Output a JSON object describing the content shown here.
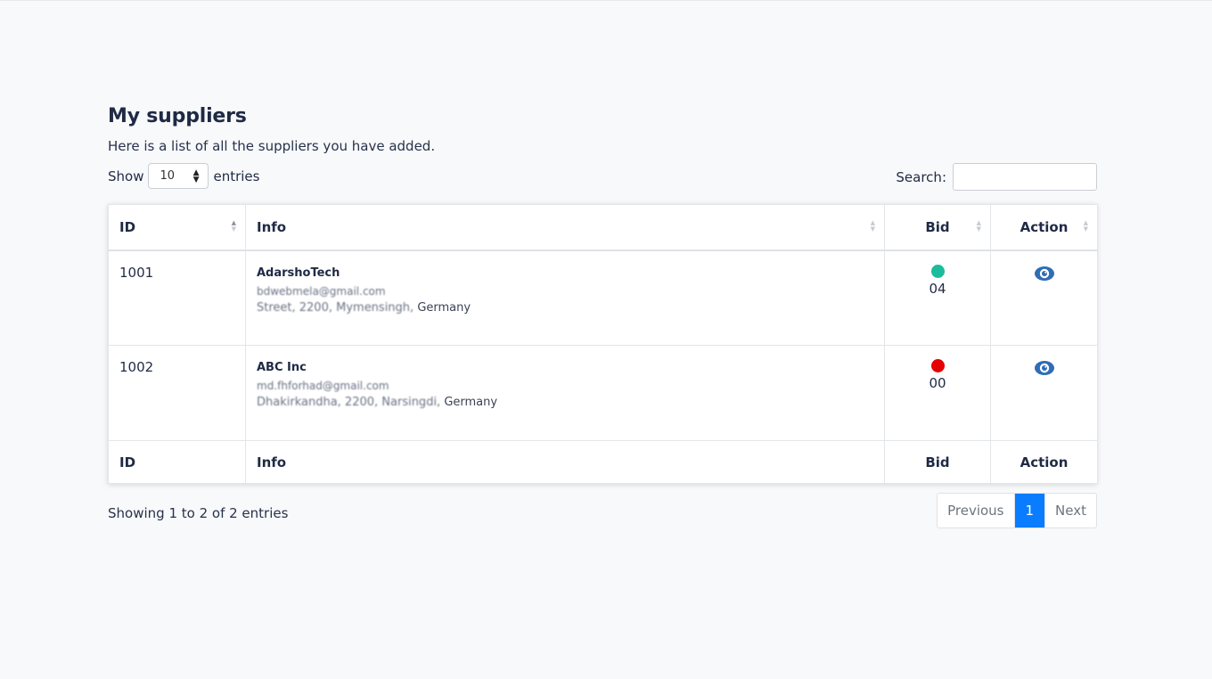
{
  "page": {
    "title": "My suppliers",
    "subtitle": "Here is a list of all the suppliers you have added."
  },
  "controls": {
    "show_label": "Show",
    "entries_value": "10",
    "entries_label": "entries",
    "search_label": "Search:",
    "search_value": ""
  },
  "table": {
    "headers": [
      "ID",
      "Info",
      "Bid",
      "Action"
    ],
    "footers": [
      "ID",
      "Info",
      "Bid",
      "Action"
    ],
    "rows": [
      {
        "id": "1001",
        "name": "AdarshoTech",
        "email": "bdwebmela@gmail.com",
        "address_blurred": "Street, 2200, Mymensingh,",
        "country": "Germany",
        "bid": "04",
        "bid_status_color": "#1abc9c",
        "action_icon": "eye-icon"
      },
      {
        "id": "1002",
        "name": "ABC Inc",
        "email": "md.fhforhad@gmail.com",
        "address_blurred": "Dhakirkandha, 2200, Narsingdi,",
        "country": "Germany",
        "bid": "00",
        "bid_status_color": "#e60000",
        "action_icon": "eye-icon"
      }
    ]
  },
  "footer": {
    "info": "Showing 1 to 2 of 2 entries",
    "prev_label": "Previous",
    "page_label": "1",
    "next_label": "Next"
  },
  "colors": {
    "accent": "#0a7cff",
    "icon_blue": "#2f6db5",
    "text": "#1f2a44",
    "background": "#f8f9fb"
  }
}
